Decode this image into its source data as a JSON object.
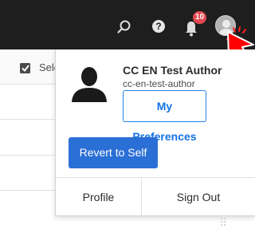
{
  "header": {
    "notification_count": "10",
    "icons": [
      "search-icon",
      "help-icon",
      "bell-icon",
      "avatar-icon"
    ]
  },
  "page": {
    "select_label": "Select"
  },
  "user_menu": {
    "name": "CC EN Test Author",
    "user_id": "cc-en-test-author",
    "preferences_label": "My Preferences",
    "revert_label": "Revert to Self",
    "profile_label": "Profile",
    "sign_out_label": "Sign Out"
  },
  "colors": {
    "topbar": "#1e1e1e",
    "badge": "#e34850",
    "accent": "#2a6fd6",
    "cursor": "#ff0000"
  }
}
